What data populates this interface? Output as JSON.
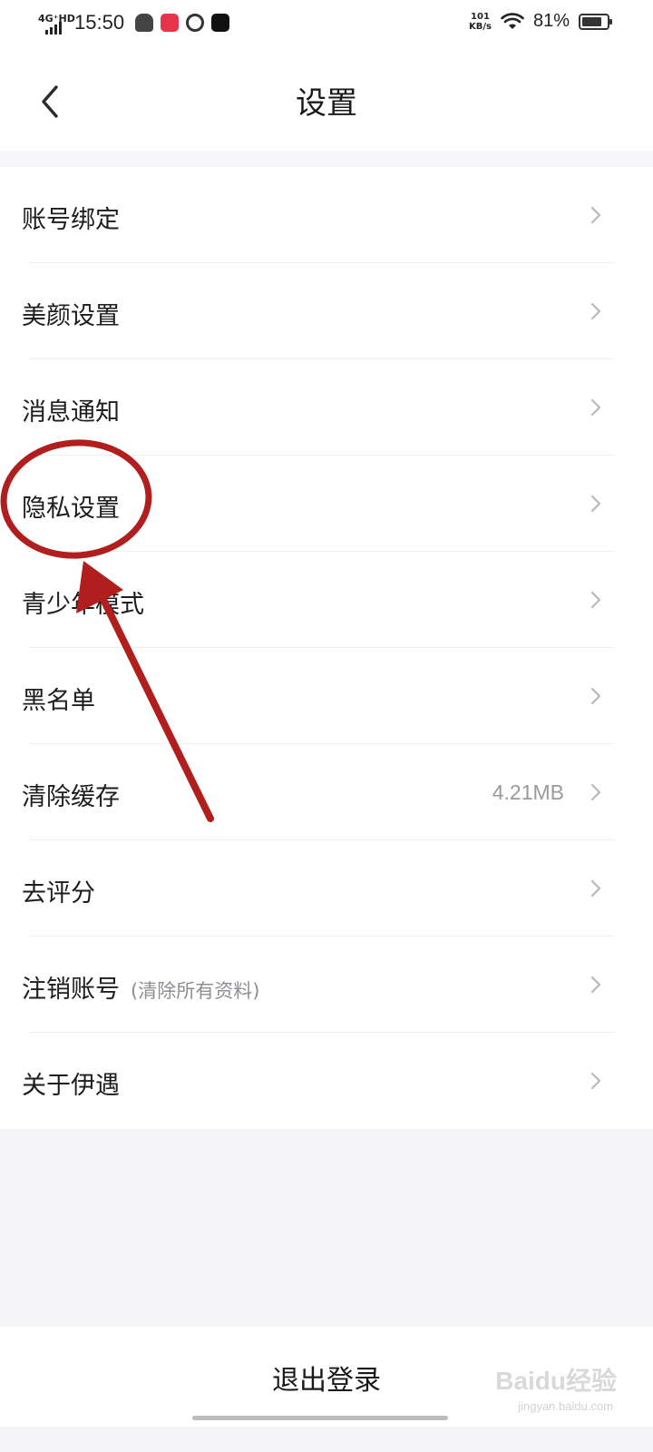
{
  "status_bar": {
    "network": "4G⁺HD",
    "time": "15:50",
    "speed_value": "101",
    "speed_unit": "KB/s",
    "battery": "81%",
    "battery_level": 0.81
  },
  "header": {
    "title": "设置",
    "back_icon": "chevron-left-icon"
  },
  "settings": {
    "items": [
      {
        "label": "账号绑定",
        "sub": "",
        "value": ""
      },
      {
        "label": "美颜设置",
        "sub": "",
        "value": ""
      },
      {
        "label": "消息通知",
        "sub": "",
        "value": ""
      },
      {
        "label": "隐私设置",
        "sub": "",
        "value": ""
      },
      {
        "label": "青少年模式",
        "sub": "",
        "value": ""
      },
      {
        "label": "黑名单",
        "sub": "",
        "value": ""
      },
      {
        "label": "清除缓存",
        "sub": "",
        "value": "4.21MB"
      },
      {
        "label": "去评分",
        "sub": "",
        "value": ""
      },
      {
        "label": "注销账号",
        "sub": "(清除所有资料)",
        "value": ""
      },
      {
        "label": "关于伊遇",
        "sub": "",
        "value": ""
      }
    ]
  },
  "footer": {
    "logout_label": "退出登录"
  },
  "watermark": {
    "brand": "Baidu经验",
    "url": "jingyan.baidu.com"
  },
  "colors": {
    "annotation": "#b01e1e",
    "background": "#f5f5f7",
    "divider": "#efeff2"
  }
}
